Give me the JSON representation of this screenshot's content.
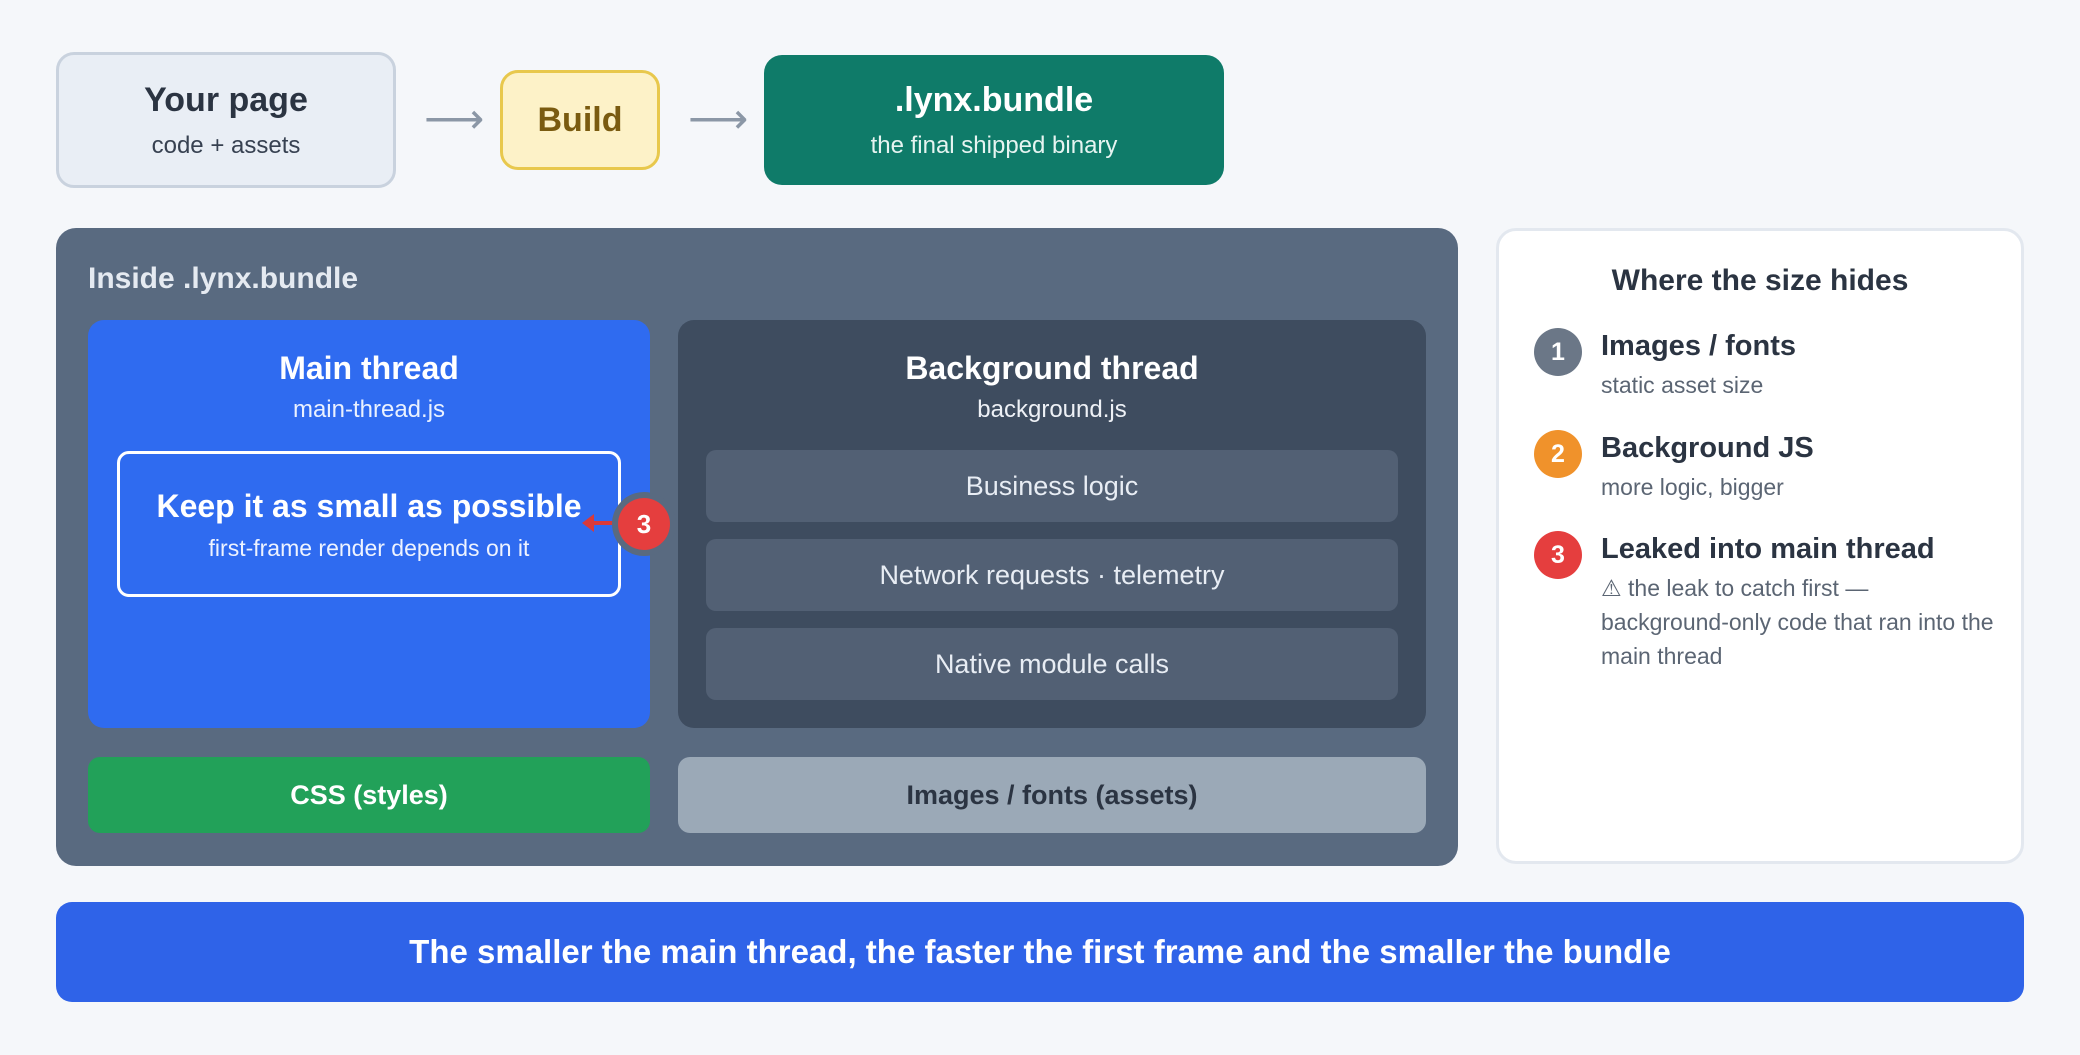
{
  "pipeline": {
    "page": {
      "title": "Your page",
      "subtitle": "code + assets"
    },
    "build": {
      "title": "Build"
    },
    "bundle": {
      "title": ".lynx.bundle",
      "subtitle": "the final shipped binary"
    },
    "arrow_glyph": "⟶"
  },
  "inside": {
    "title": "Inside .lynx.bundle",
    "main_thread": {
      "title": "Main thread",
      "file": "main-thread.js",
      "keep_title": "Keep it as small as possible",
      "keep_sub": "first-frame render depends on it",
      "leak_badge": "3"
    },
    "background_thread": {
      "title": "Background thread",
      "file": "background.js",
      "items": [
        "Business logic",
        "Network requests · telemetry",
        "Native module calls"
      ]
    },
    "css_label": "CSS (styles)",
    "assets_label": "Images / fonts (assets)"
  },
  "legend": {
    "title": "Where the size hides",
    "items": [
      {
        "num": "1",
        "title": "Images / fonts",
        "desc": "static asset size",
        "color": "#6b7787"
      },
      {
        "num": "2",
        "title": "Background JS",
        "desc": "more logic, bigger",
        "color": "#f0922b"
      },
      {
        "num": "3",
        "title": "Leaked into main thread",
        "desc": "⚠ the leak to catch first — background-only code that ran into the main thread",
        "color": "#e53e3e"
      }
    ]
  },
  "footer": {
    "text": "The smaller the main thread, the faster the first frame and the smaller the bundle"
  },
  "colors": {
    "main_thread": "#2f6bf0",
    "background_thread": "#3e4c5f",
    "bundle": "#0f7b69",
    "css": "#22a159",
    "assets": "#9ba9b7",
    "leak": "#e53e3e"
  }
}
